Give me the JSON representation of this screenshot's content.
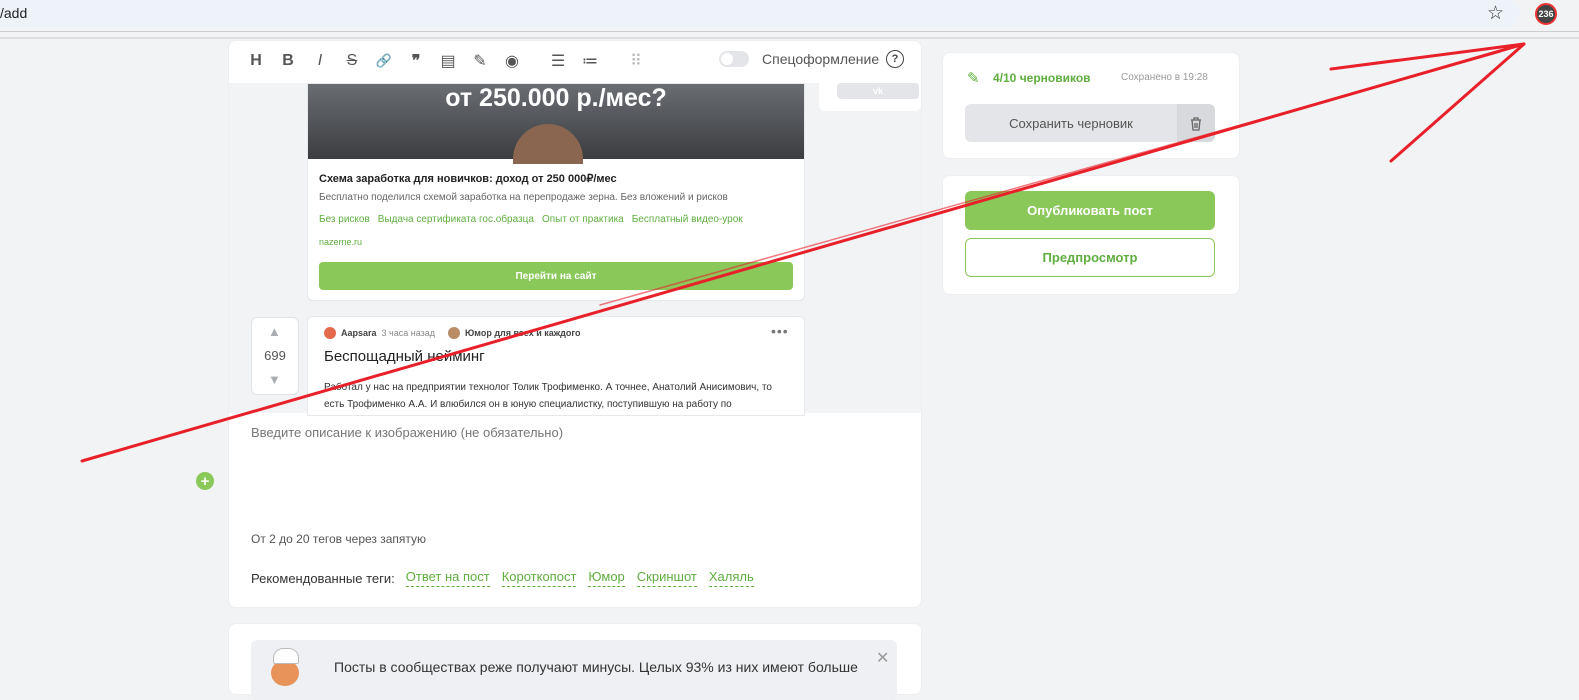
{
  "browser": {
    "address": "/add",
    "star_icon": "star-icon",
    "extension_badge": "236"
  },
  "toolbar": {
    "buttons": [
      "H",
      "B",
      "I",
      "S",
      "🔗",
      "❞",
      "▤",
      "✎",
      "◉",
      "☰",
      "≔",
      "⠿"
    ],
    "spec_label": "Спецоформление",
    "help_label": "?"
  },
  "ad": {
    "image_text": "от 250.000 р./мес?",
    "title": "Схема заработка для новичков: доход от 250 000₽/мес",
    "description": "Бесплатно поделился схемой заработка на перепродаже зерна. Без вложений и рисков",
    "links": [
      "Без рисков",
      "Выдача сертификата гос.образца",
      "Опыт от практика",
      "Бесплатный видео-урок"
    ],
    "domain": "nazerne.ru",
    "button": "Перейти на сайт"
  },
  "share": {
    "vk": "vk"
  },
  "post": {
    "votes": "699",
    "author": "Aapsara",
    "time": "3 часа назад",
    "community": "Юмор для всех и каждого",
    "dots": "•••",
    "title": "Беспощадный нейминг",
    "text_line1": "Работал у нас на предприятии технолог Толик Трофименко. А точнее, Анатолий Анисимович, то",
    "text_line2": "есть Трофименко А.А. И влюбился он в юную специалистку, поступившую на работу по"
  },
  "editor": {
    "description_placeholder": "Введите описание к изображению (не обязательно)",
    "tags_hint": "От 2 до 20 тегов через запятую",
    "recommended_label": "Рекомендованные теги:",
    "recommended_tags": [
      "Ответ на пост",
      "Короткопост",
      "Юмор",
      "Скриншот",
      "Халяль"
    ]
  },
  "notice": {
    "text": "Посты в сообществах реже получают минусы. Целых 93% из них имеют больше"
  },
  "sidebar": {
    "drafts_count": "4/10 черновиков",
    "saved_at": "Сохранено в 19:28",
    "save_draft": "Сохранить черновик",
    "publish": "Опубликовать пост",
    "preview": "Предпросмотр"
  },
  "colors": {
    "accent_green": "#8ac85a",
    "link_green": "#5fae3f",
    "annotation_red": "#e8202a"
  }
}
